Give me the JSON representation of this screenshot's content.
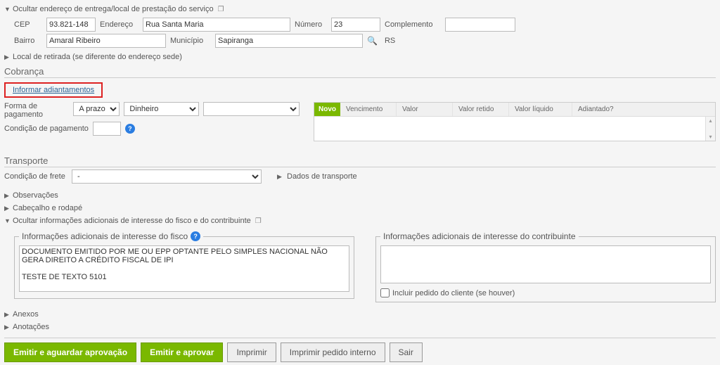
{
  "address_panel": {
    "title": "Ocultar endereço de entrega/local de prestação do serviço",
    "cep_label": "CEP",
    "cep": "93.821-148",
    "endereco_label": "Endereço",
    "endereco": "Rua Santa Maria",
    "numero_label": "Número",
    "numero": "23",
    "complemento_label": "Complemento",
    "complemento": "",
    "bairro_label": "Bairro",
    "bairro": "Amaral Ribeiro",
    "municipio_label": "Município",
    "municipio": "Sapiranga",
    "uf": "RS"
  },
  "pickup_toggle": "Local de retirada (se diferente do endereço sede)",
  "billing": {
    "title": "Cobrança",
    "adiantamentos_link": "Informar adiantamentos",
    "forma_label": "Forma de pagamento",
    "forma_opt1": "A prazo",
    "forma_opt2": "Dinheiro",
    "forma_opt3": "",
    "condicao_label": "Condição de pagamento",
    "condicao": "",
    "grid": {
      "novo": "Novo",
      "col1": "Vencimento",
      "col2": "Valor",
      "col3": "Valor retido",
      "col4": "Valor líquido",
      "col5": "Adiantado?"
    }
  },
  "transport": {
    "title": "Transporte",
    "frete_label": "Condição de frete",
    "frete_value": "-",
    "dados_link": "Dados de transporte"
  },
  "toggles": {
    "obs": "Observações",
    "cabecalho": "Cabeçalho e rodapé",
    "info_adicionais": "Ocultar informações adicionais de interesse do fisco e do contribuinte"
  },
  "info": {
    "fisco_legend": "Informações adicionais de interesse do fisco",
    "fisco_text": "DOCUMENTO EMITIDO POR ME OU EPP OPTANTE PELO SIMPLES NACIONAL NÃO GERA DIREITO A CRÉDITO FISCAL DE IPI\n\nTESTE DE TEXTO 5101",
    "contrib_legend": "Informações adicionais de interesse do contribuinte",
    "contrib_text": "",
    "incluir_pedido": "Incluir pedido do cliente (se houver)"
  },
  "bottom_toggles": {
    "anexos": "Anexos",
    "anotacoes": "Anotações"
  },
  "actions": {
    "emitir_aguardar": "Emitir e aguardar aprovação",
    "emitir_aprovar": "Emitir e aprovar",
    "imprimir": "Imprimir",
    "imprimir_interno": "Imprimir pedido interno",
    "sair": "Sair"
  }
}
